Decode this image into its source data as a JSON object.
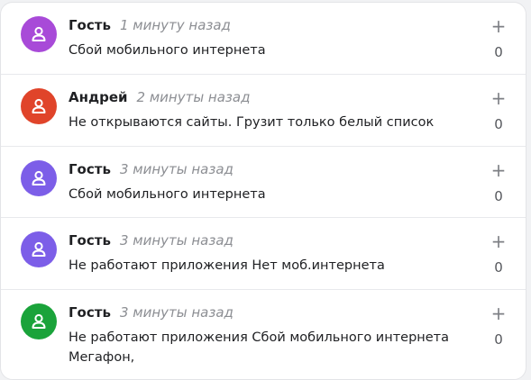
{
  "comments": [
    {
      "author": "Гость",
      "time": "1 минуту назад",
      "text": "Сбой мобильного интернета",
      "vote_plus": "+",
      "score": "0",
      "avatar_color": "#a84ad8",
      "avatar_icon": "user-icon"
    },
    {
      "author": "Андрей",
      "time": "2 минуты назад",
      "text": "Не открываются сайты. Грузит только белый список",
      "vote_plus": "+",
      "score": "0",
      "avatar_color": "#e0442a",
      "avatar_icon": "user-icon"
    },
    {
      "author": "Гость",
      "time": "3 минуты назад",
      "text": "Сбой мобильного интернета",
      "vote_plus": "+",
      "score": "0",
      "avatar_color": "#7c5ee8",
      "avatar_icon": "user-icon"
    },
    {
      "author": "Гость",
      "time": "3 минуты назад",
      "text": "Не работают приложения Нет моб.интернета",
      "vote_plus": "+",
      "score": "0",
      "avatar_color": "#7c5ee8",
      "avatar_icon": "user-icon"
    },
    {
      "author": "Гость",
      "time": "3 минуты назад",
      "text": "Не работают приложения Сбой мобильного интернета Мегафон,",
      "vote_plus": "+",
      "score": "0",
      "avatar_color": "#1aa33a",
      "avatar_icon": "user-icon"
    }
  ]
}
